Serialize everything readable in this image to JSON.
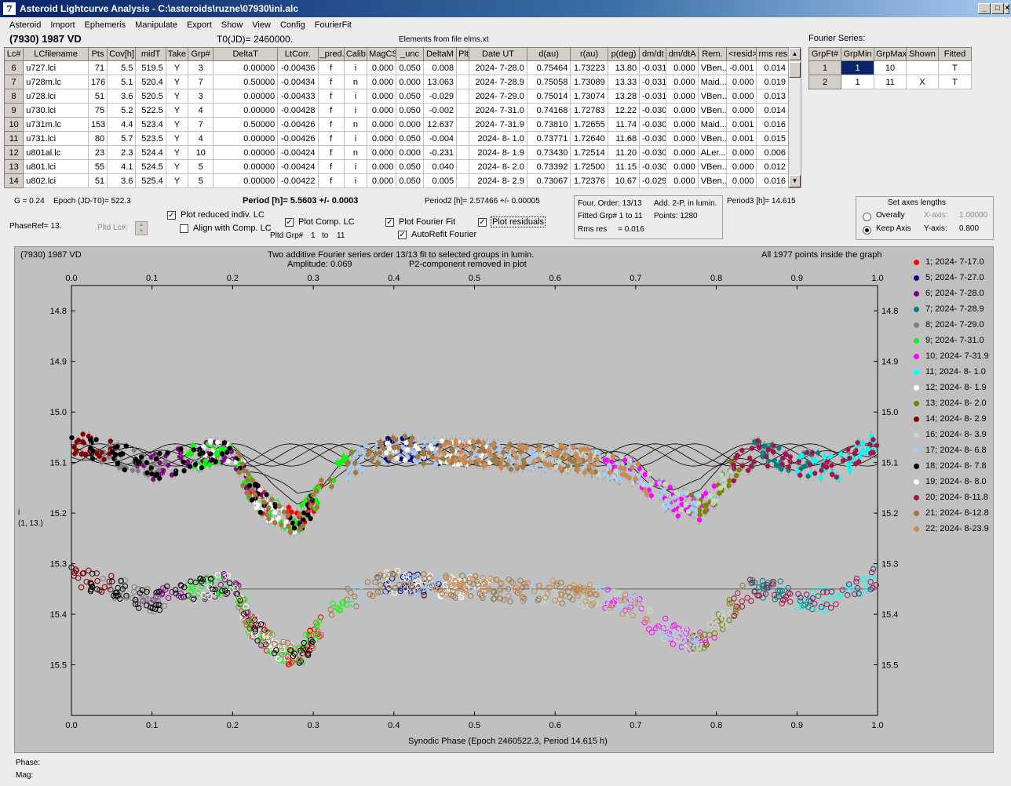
{
  "window": {
    "title": "Asteroid Lightcurve Analysis - C:\\asteroids\\ruzne\\07930\\ini.alc",
    "icon_glyph": "7",
    "min": "_",
    "max": "□",
    "close": "×"
  },
  "menu": [
    "Asteroid",
    "Import",
    "Ephemeris",
    "Manipulate",
    "Export",
    "Show",
    "View",
    "Config",
    "FourierFit"
  ],
  "header": {
    "asteroid": "(7930) 1987 VD",
    "t0": "T0(JD)= 2460000.",
    "elements": "Elements from file elms.xt",
    "fourier_series_label": "Fourier Series:"
  },
  "lc_table": {
    "columns": [
      "Lc#",
      "LCfilename",
      "Pts",
      "Cov[h]",
      "midT",
      "Take",
      "Grp#",
      "DeltaT",
      "LtCorr.",
      "_pred.",
      "Calib.",
      "MagCS",
      "_unc",
      "DeltaM",
      "Plt",
      "Date UT",
      "d(au)",
      "r(au)",
      "p(deg)",
      "dm/dt",
      "dm/dtA",
      "Rem.",
      "<resid>",
      "rms res"
    ],
    "rows": [
      [
        "6",
        "u727.lci",
        "71",
        "5.5",
        "519.5",
        "Y",
        "3",
        "0.00000",
        "-0.00436",
        "f",
        "i",
        "0.000",
        "0.050",
        "0.008",
        "",
        "2024- 7-28.0",
        "0.75464",
        "1.73223",
        "13.80",
        "-0.031",
        "0.000",
        "VBen...",
        "-0.001",
        "0.014"
      ],
      [
        "7",
        "u728m.lc",
        "176",
        "5.1",
        "520.4",
        "Y",
        "7",
        "0.50000",
        "-0.00434",
        "f",
        "n",
        "0.000",
        "0.000",
        "13.063",
        "",
        "2024- 7-28.9",
        "0.75058",
        "1.73089",
        "13.33",
        "-0.031",
        "0.000",
        "Maid...",
        "0.000",
        "0.019"
      ],
      [
        "8",
        "u728.lci",
        "51",
        "3.6",
        "520.5",
        "Y",
        "3",
        "0.00000",
        "-0.00433",
        "f",
        "i",
        "0.000",
        "0.050",
        "-0.029",
        "",
        "2024- 7-29.0",
        "0.75014",
        "1.73074",
        "13.28",
        "-0.031",
        "0.000",
        "VBen...",
        "0.000",
        "0.013"
      ],
      [
        "9",
        "u730.lci",
        "75",
        "5.2",
        "522.5",
        "Y",
        "4",
        "0.00000",
        "-0.00428",
        "f",
        "i",
        "0.000",
        "0.050",
        "-0.002",
        "",
        "2024- 7-31.0",
        "0.74168",
        "1.72783",
        "12.22",
        "-0.030",
        "0.000",
        "VBen...",
        "0.000",
        "0.014"
      ],
      [
        "10",
        "u731m.lc",
        "153",
        "4.4",
        "523.4",
        "Y",
        "7",
        "0.50000",
        "-0.00426",
        "f",
        "n",
        "0.000",
        "0.000",
        "12.637",
        "",
        "2024- 7-31.9",
        "0.73810",
        "1.72655",
        "11.74",
        "-0.030",
        "0.000",
        "Maid...",
        "0.001",
        "0.016"
      ],
      [
        "11",
        "u731.lci",
        "80",
        "5.7",
        "523.5",
        "Y",
        "4",
        "0.00000",
        "-0.00426",
        "f",
        "i",
        "0.000",
        "0.050",
        "-0.004",
        "",
        "2024- 8- 1.0",
        "0.73771",
        "1.72640",
        "11.68",
        "-0.030",
        "0.000",
        "VBen...",
        "0.001",
        "0.015"
      ],
      [
        "12",
        "u801al.lc",
        "23",
        "2.3",
        "524.4",
        "Y",
        "10",
        "0.00000",
        "-0.00424",
        "f",
        "n",
        "0.000",
        "0.000",
        "-0.231",
        "",
        "2024- 8- 1.9",
        "0.73430",
        "1.72514",
        "11.20",
        "-0.030",
        "0.000",
        "ALer...",
        "0.000",
        "0.006"
      ],
      [
        "13",
        "u801.lci",
        "55",
        "4.1",
        "524.5",
        "Y",
        "5",
        "0.00000",
        "-0.00424",
        "f",
        "i",
        "0.000",
        "0.050",
        "0.040",
        "",
        "2024- 8- 2.0",
        "0.73392",
        "1.72500",
        "11.15",
        "-0.030",
        "0.000",
        "VBen...",
        "0.000",
        "0.012"
      ],
      [
        "14",
        "u802.lci",
        "51",
        "3.6",
        "525.4",
        "Y",
        "5",
        "0.00000",
        "-0.00422",
        "f",
        "i",
        "0.000",
        "0.050",
        "0.005",
        "",
        "2024- 8- 2.9",
        "0.73067",
        "1.72376",
        "10.67",
        "-0.029",
        "0.000",
        "VBen...",
        "0.000",
        "0.016"
      ]
    ]
  },
  "fourier_table": {
    "columns": [
      "GrpFt#",
      "GrpMin",
      "GrpMax",
      "Shown",
      "Fitted"
    ],
    "rows": [
      [
        "1",
        "1",
        "10",
        "",
        "T"
      ],
      [
        "2",
        "1",
        "11",
        "X",
        "T"
      ]
    ]
  },
  "params": {
    "g": "G = 0.24",
    "epoch": "Epoch (JD-T0)= 522.3",
    "period": "Period [h]= 5.5603 +/- 0.0003",
    "period2": "Period2 [h]= 2.57466 +/- 0.00005",
    "period3": "Period3 [h]= 14.615",
    "phaseref": "PhaseRef= 13.",
    "pltd_lc": "Pltd Lc#:",
    "pltd_grp": "Pltd Grp#",
    "pltd_grp_from": "1",
    "pltd_grp_to_label": "to",
    "pltd_grp_to": "11"
  },
  "checkboxes": {
    "plot_reduced": {
      "label": "Plot reduced indiv. LC",
      "checked": true
    },
    "align_comp": {
      "label": "Align with Comp. LC",
      "checked": false
    },
    "plot_comp": {
      "label": "Plot Comp. LC",
      "checked": true
    },
    "plot_fourier": {
      "label": "Plot Fourier Fit",
      "checked": true
    },
    "autorefit": {
      "label": "AutoRefit Fourier",
      "checked": true
    },
    "plot_residuals": {
      "label": "Plot residuals",
      "checked": true
    },
    "check_glyph": "✓"
  },
  "fourier_info": {
    "order": "Four. Order: 13/13",
    "add": "Add. 2-P, in lumin.",
    "fitted": "Fitted Grp# 1 to 11",
    "points": "Points: 1280",
    "rms": "Rms res     = 0.016"
  },
  "axes_box": {
    "title": "Set axes lengths",
    "overall": "Overally",
    "keep": "Keep Axis",
    "xaxis_label": "X-axis:",
    "xaxis_val": "1.00000",
    "yaxis_label": "Y-axis:",
    "yaxis_val": "0.800"
  },
  "plot": {
    "name": "(7930) 1987 VD",
    "line1": "Two additive Fourier series order 13/13 fit to selected groups in lumin.",
    "line2a": "Amplitude: 0.069",
    "line2b": "P2-component removed in plot",
    "points_note": "All 1977 points inside the graph",
    "ylabel1": "i",
    "ylabel2": "(1, 13.)",
    "xlabel": "Synodic Phase (Epoch 2460522.3, Period 14.615 h)"
  },
  "chart_data": {
    "type": "scatter",
    "xlim": [
      0.0,
      1.0
    ],
    "ylim": [
      14.75,
      15.6
    ],
    "y_inverted": true,
    "x_ticks": [
      0.0,
      0.1,
      0.2,
      0.3,
      0.4,
      0.5,
      0.6,
      0.7,
      0.8,
      0.9,
      1.0
    ],
    "x_tick_labels": [
      "0.0",
      "0.1",
      "0.2",
      "0.3",
      "0.4",
      "0.5",
      "0.6",
      "0.7",
      "0.8",
      "0.9",
      "1.0"
    ],
    "y_ticks": [
      14.8,
      14.9,
      15.0,
      15.1,
      15.2,
      15.3,
      15.4,
      15.5
    ],
    "y_tick_labels": [
      "14.8",
      "14.9",
      "15.0",
      "15.1",
      "15.2",
      "15.3",
      "15.4",
      "15.5"
    ],
    "reference_line_y": 15.35,
    "grid": false,
    "legend_position": "right",
    "composite_profile": {
      "x": [
        0.0,
        0.05,
        0.1,
        0.15,
        0.2,
        0.22,
        0.25,
        0.28,
        0.3,
        0.33,
        0.36,
        0.4,
        0.45,
        0.5,
        0.55,
        0.6,
        0.65,
        0.7,
        0.72,
        0.75,
        0.78,
        0.8,
        0.83,
        0.85,
        0.9,
        0.95,
        1.0
      ],
      "y": [
        15.06,
        15.08,
        15.11,
        15.09,
        15.07,
        15.15,
        15.2,
        15.22,
        15.18,
        15.12,
        15.09,
        15.07,
        15.08,
        15.08,
        15.09,
        15.09,
        15.1,
        15.12,
        15.15,
        15.18,
        15.19,
        15.16,
        15.1,
        15.08,
        15.1,
        15.11,
        15.06
      ]
    },
    "residual_offset": 0.3,
    "series": [
      {
        "name": "1; 2024- 7-17.0",
        "color": "#ff0000",
        "x_range": [
          0.22,
          0.31
        ]
      },
      {
        "name": "5; 2024- 7-27.0",
        "color": "#000080",
        "x_range": [
          0.38,
          0.46
        ]
      },
      {
        "name": "6; 2024- 7-28.0",
        "color": "#800080",
        "x_range": [
          0.08,
          0.24
        ]
      },
      {
        "name": "7; 2024- 7-28.9",
        "color": "#008080",
        "x_range": [
          0.84,
          0.93
        ]
      },
      {
        "name": "8; 2024- 7-29.0",
        "color": "#808080",
        "x_range": [
          0.03,
          0.12
        ]
      },
      {
        "name": "9; 2024- 7-31.0",
        "color": "#00ff00",
        "x_range": [
          0.14,
          0.35
        ]
      },
      {
        "name": "10; 2024- 7-31.9",
        "color": "#ff00ff",
        "x_range": [
          0.66,
          0.8
        ]
      },
      {
        "name": "11; 2024- 8- 1.0",
        "color": "#00ffff",
        "x_range": [
          0.9,
          1.0
        ]
      },
      {
        "name": "12; 2024- 8- 1.9",
        "color": "#ffffff",
        "x_range": [
          0.15,
          0.28
        ]
      },
      {
        "name": "13; 2024- 8- 2.0",
        "color": "#808000",
        "x_range": [
          0.76,
          0.84
        ]
      },
      {
        "name": "14; 2024- 8- 2.9",
        "color": "#800000",
        "x_range": [
          0.0,
          0.05
        ]
      },
      {
        "name": "16; 2024- 8- 3.9",
        "color": "#c0dcc0",
        "x_range": [
          0.58,
          0.82
        ]
      },
      {
        "name": "17; 2024- 8- 6.8",
        "color": "#a6caf0",
        "x_range": [
          0.34,
          0.78
        ]
      },
      {
        "name": "18; 2024- 8- 7.8",
        "color": "#000000",
        "x_range": [
          0.0,
          0.3
        ]
      },
      {
        "name": "19; 2024- 8- 8.0",
        "color": "#fffbf0",
        "x_range": [
          0.38,
          0.52
        ]
      },
      {
        "name": "20; 2024- 8-11.8",
        "color": "#a0164c",
        "x_range": [
          0.82,
          1.0
        ]
      },
      {
        "name": "21; 2024- 8-12.8",
        "color": "#a07840",
        "x_range": [
          0.2,
          0.66
        ]
      },
      {
        "name": "22; 2024- 8-23.9",
        "color": "#d08850",
        "x_range": [
          0.45,
          0.72
        ]
      }
    ]
  },
  "status": {
    "phase": "Phase:",
    "mag": "Mag:"
  }
}
